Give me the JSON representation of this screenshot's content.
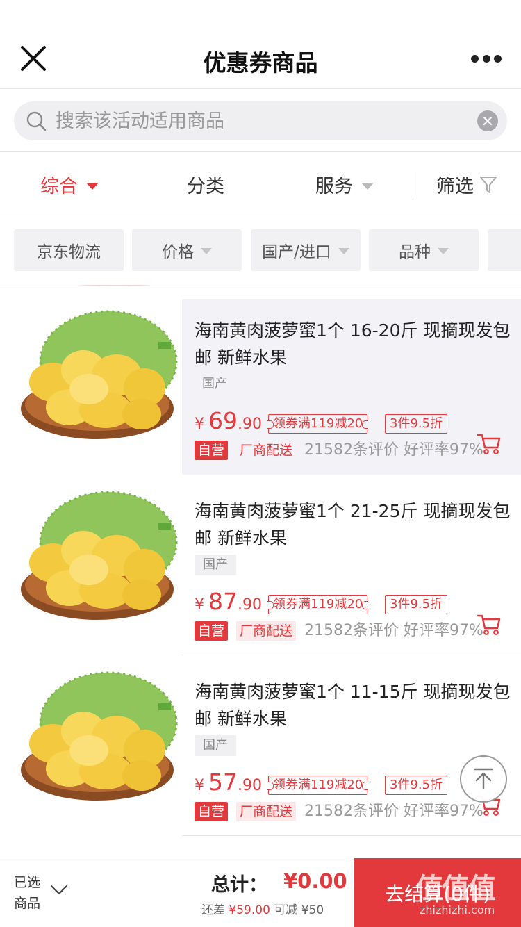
{
  "header": {
    "title": "优惠券商品"
  },
  "search": {
    "placeholder": "搜索该活动适用商品"
  },
  "sort": {
    "items": [
      "综合",
      "分类",
      "服务",
      "筛选"
    ]
  },
  "filters": {
    "chips": [
      "京东物流",
      "价格",
      "国产/进口",
      "品种"
    ]
  },
  "products": [
    {
      "title": "海南黄肉菠萝蜜1个 16-20斤 现摘现发包邮 新鲜水果",
      "origin": "国产",
      "price_currency": "¥",
      "price_int": "69",
      "price_dec": ".90",
      "coupon": "领券满119减20",
      "promo": "3件9.5折",
      "self_label": "自营",
      "ship_label": "厂商配送",
      "reviews": "21582条评价  好评率97%"
    },
    {
      "title": "海南黄肉菠萝蜜1个 21-25斤 现摘现发包邮 新鲜水果",
      "origin": "国产",
      "price_currency": "¥",
      "price_int": "87",
      "price_dec": ".90",
      "coupon": "领券满119减20",
      "promo": "3件9.5折",
      "self_label": "自营",
      "ship_label": "厂商配送",
      "reviews": "21582条评价  好评率97%"
    },
    {
      "title": "海南黄肉菠萝蜜1个 11-15斤 现摘现发包邮 新鲜水果",
      "origin": "国产",
      "price_currency": "¥",
      "price_int": "57",
      "price_dec": ".90",
      "coupon": "领券满119减20",
      "promo": "3件9.5折",
      "self_label": "自营",
      "ship_label": "厂商配送",
      "reviews": "21582条评价  好评率97%"
    }
  ],
  "footer": {
    "selected_line1": "已选",
    "selected_line2": "商品",
    "total_label": "总计：",
    "total_value": "¥0.00",
    "diff_label": "还差",
    "diff_value": "¥59.00",
    "reduce_label": "可减",
    "reduce_value": "¥50",
    "checkout_label": "去结算(0件)"
  },
  "watermark": {
    "main": "值值值",
    "sub": "zhizhizhi.com"
  },
  "colors": {
    "accent": "#e4393c",
    "text": "#222222",
    "muted": "#999999"
  }
}
